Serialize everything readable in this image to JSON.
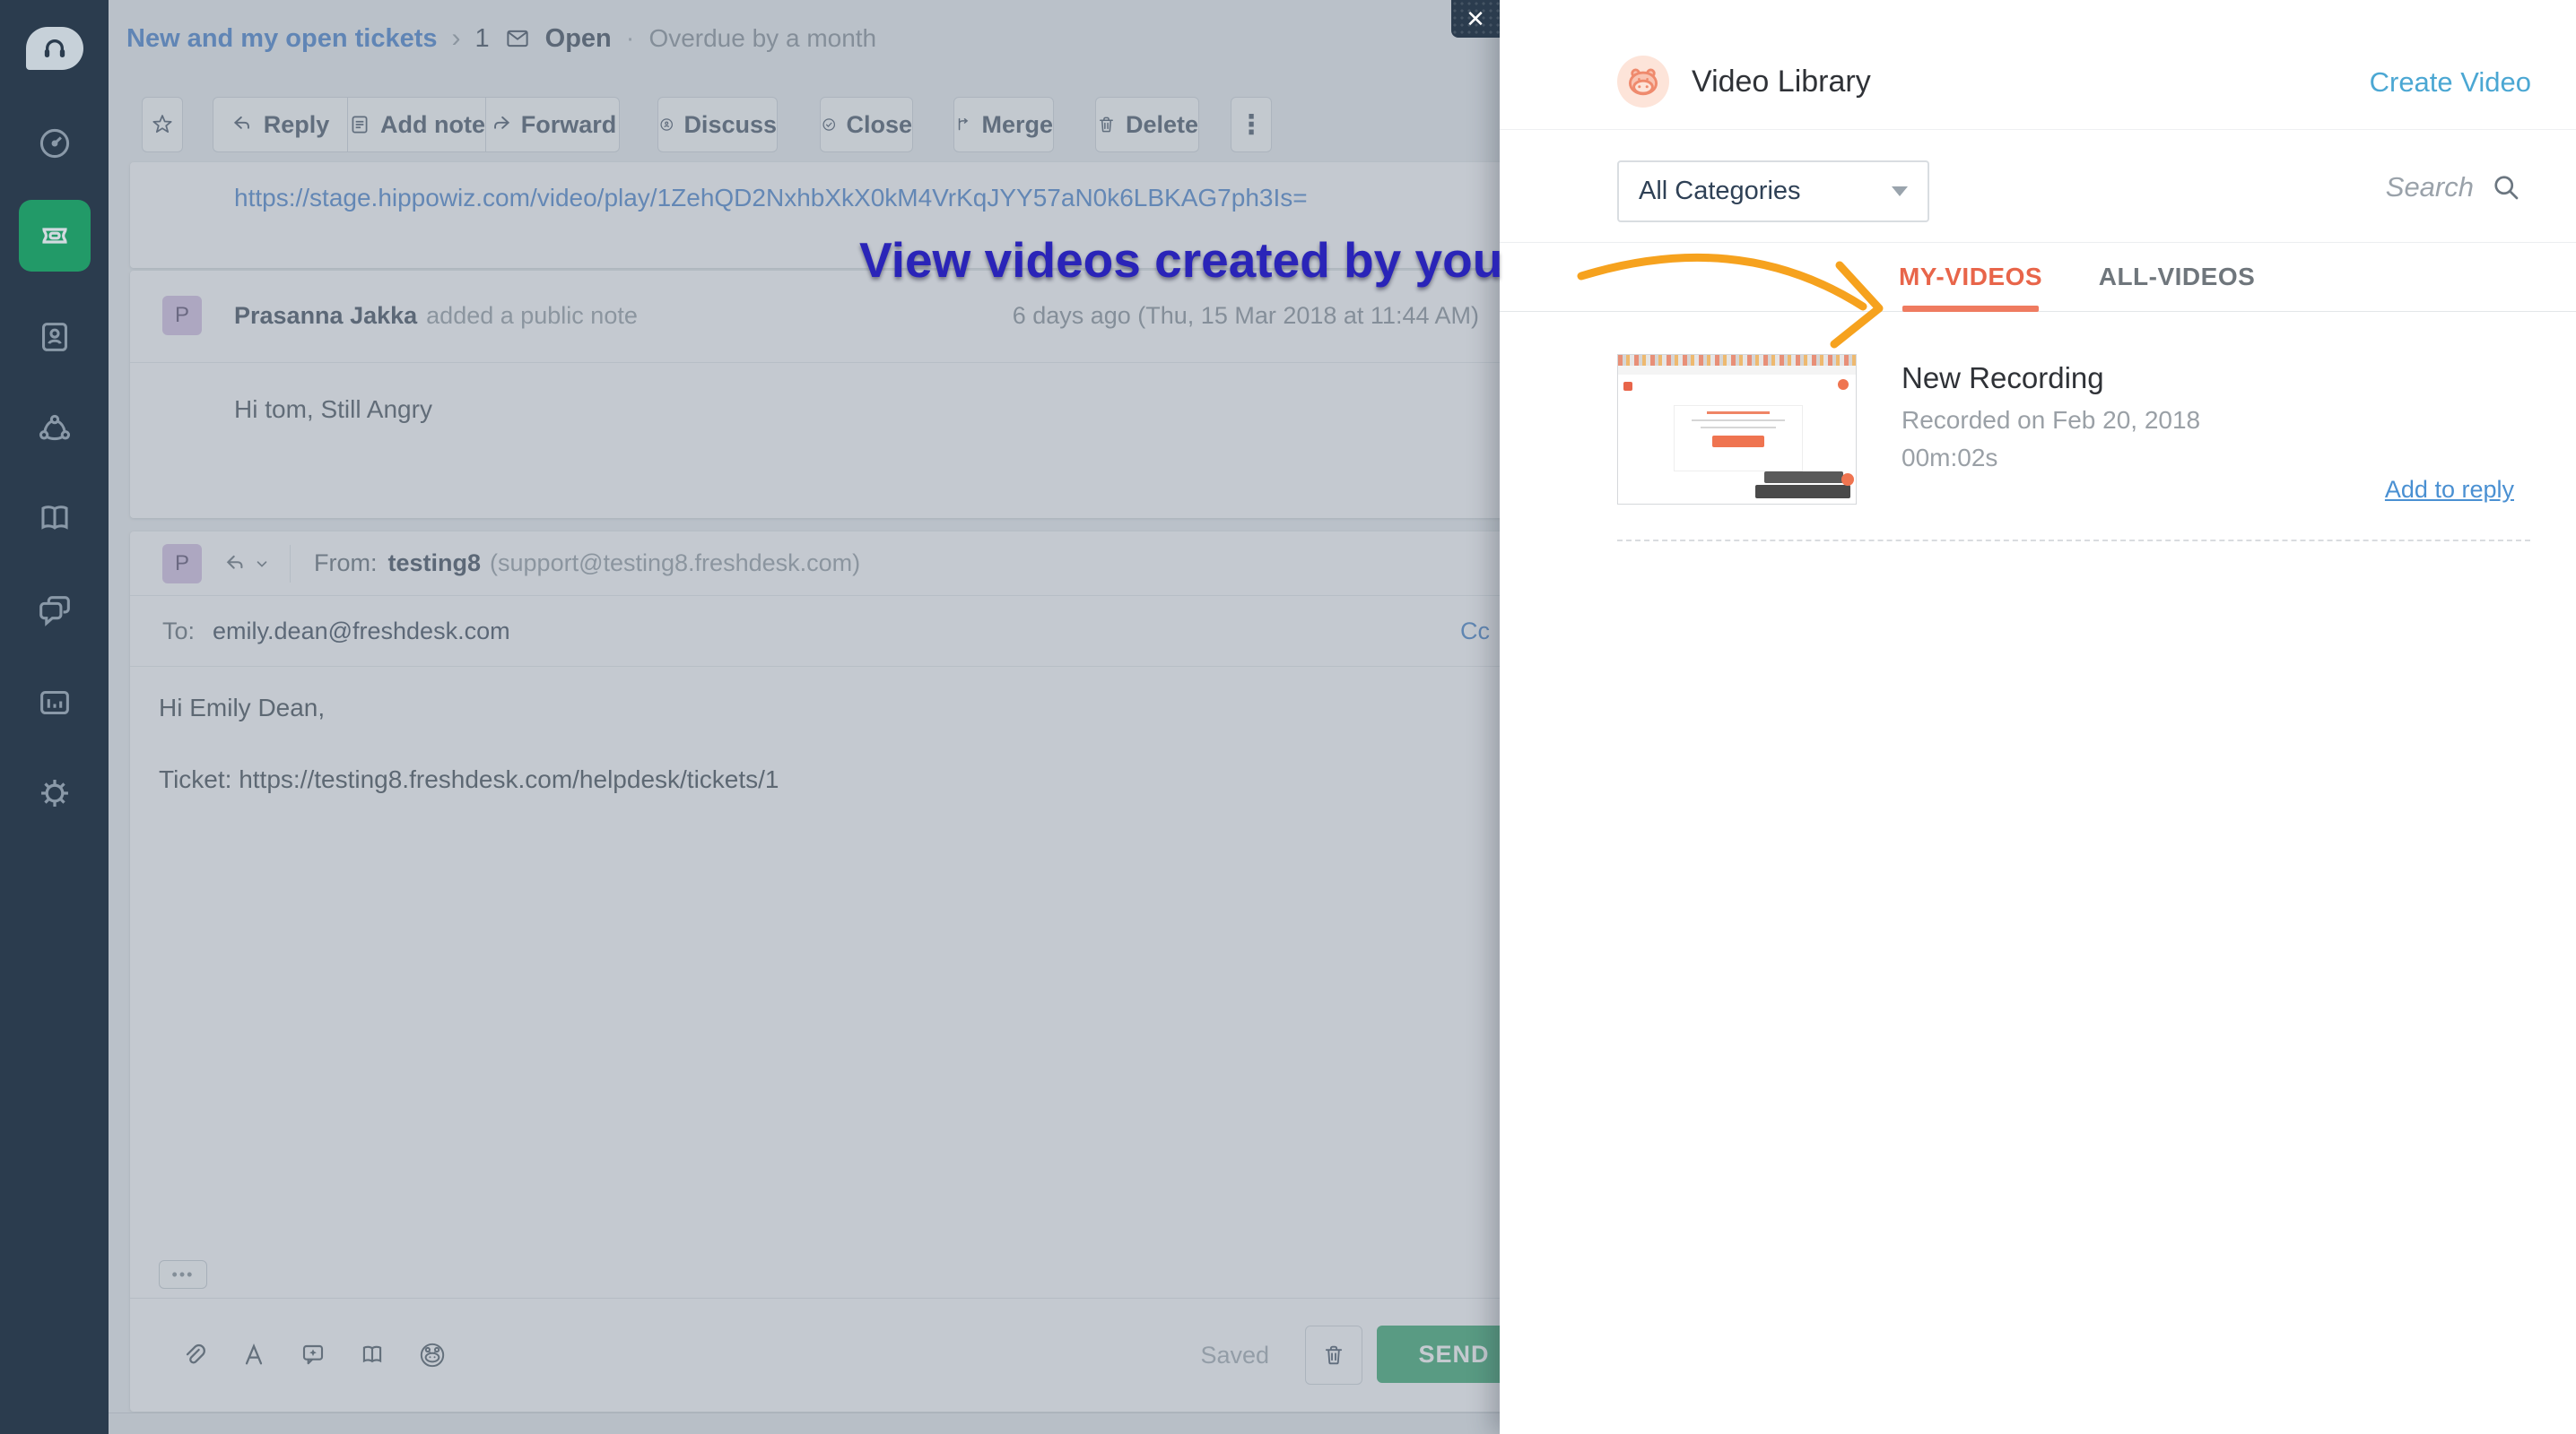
{
  "sidebar": {
    "logo_icon": "freshdesk-headset-logo",
    "items": [
      {
        "name": "dashboard",
        "active": false
      },
      {
        "name": "tickets",
        "active": true
      },
      {
        "name": "contacts",
        "active": false
      },
      {
        "name": "community",
        "active": false
      },
      {
        "name": "solutions",
        "active": false
      },
      {
        "name": "forums",
        "active": false
      },
      {
        "name": "reports",
        "active": false
      },
      {
        "name": "settings",
        "active": false
      }
    ]
  },
  "topbar": {
    "filter_link": "New and my open tickets",
    "separator": "›",
    "ticket_number": "1",
    "status_icon": "envelope-icon",
    "status_label": "Open",
    "dot": "·",
    "due_label": "Overdue by a month"
  },
  "toolbar": {
    "star_icon": "star-icon",
    "reply_label": "Reply",
    "add_note_label": "Add note",
    "forward_label": "Forward",
    "discuss_label": "Discuss",
    "close_label": "Close",
    "merge_label": "Merge",
    "delete_label": "Delete",
    "more_label": "⋮"
  },
  "conversation": {
    "link_message_url": "https://stage.hippowiz.com/video/play/1ZehQD2NxhbXkX0kM4VrKqJYY57aN0k6LBKAG7ph3Is=",
    "note": {
      "avatar_initial": "P",
      "author": "Prasanna Jakka",
      "action": "added a public note",
      "timestamp": "6 days ago (Thu, 15 Mar 2018 at 11:44 AM)",
      "body": "Hi tom, Still Angry"
    }
  },
  "editor": {
    "avatar_initial": "P",
    "from_label": "From:",
    "from_name": "testing8",
    "from_address": "(support@testing8.freshdesk.com)",
    "to_label": "To:",
    "to_address": "emily.dean@freshdesk.com",
    "cc_label": "Cc",
    "greeting": "Hi Emily Dean,",
    "ticket_line": "Ticket: https://testing8.freshdesk.com/helpdesk/tickets/1",
    "quoted_text_toggle": "•••",
    "saved_label": "Saved",
    "send_label": "SEND"
  },
  "annotation": {
    "text": "View videos created by you",
    "arrow_icon": "hand-drawn-arrow"
  },
  "video_panel": {
    "close_label": "✕",
    "logo_icon": "hippo-video-logo",
    "title": "Video Library",
    "create_video_label": "Create Video",
    "category_dropdown_value": "All Categories",
    "search_placeholder": "Search",
    "tabs": {
      "my_videos": "MY-VIDEOS",
      "all_videos": "ALL-VIDEOS"
    },
    "video": {
      "title": "New Recording",
      "recorded_on": "Recorded on Feb 20, 2018",
      "duration": "00m:02s",
      "add_to_reply_label": "Add to reply"
    }
  },
  "colors": {
    "sidebar_bg": "#2b3c4e",
    "active_icon_green": "#229a68",
    "link_blue": "#3575c9",
    "tab_active_orange": "#e8654a",
    "create_video_blue": "#4ba7d3",
    "annotation_blue": "#2a24b8",
    "arrow_orange": "#f6a21e",
    "send_green": "#26a164"
  }
}
